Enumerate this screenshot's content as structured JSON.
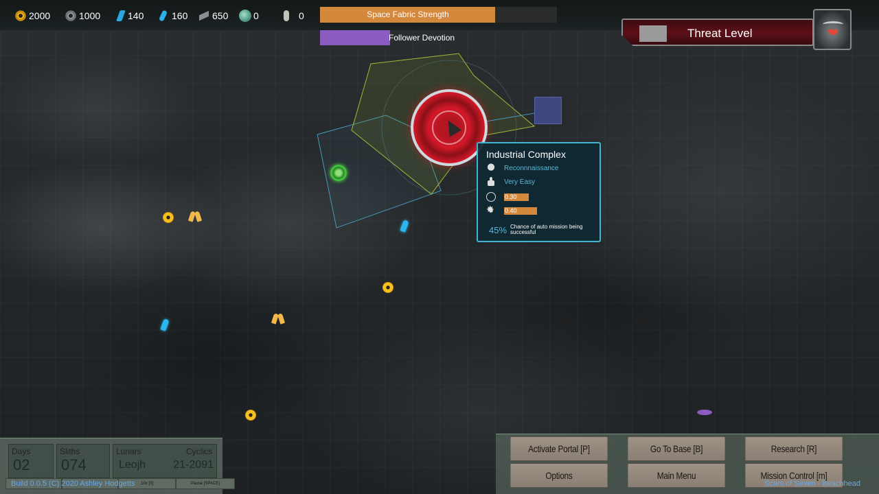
{
  "resources": [
    {
      "icon": "gear-icon",
      "value": "2000"
    },
    {
      "icon": "cog-icon",
      "value": "1000"
    },
    {
      "icon": "crystal-icon",
      "value": "140"
    },
    {
      "icon": "shard-icon",
      "value": "160"
    },
    {
      "icon": "metal-icon",
      "value": "650"
    },
    {
      "icon": "orb-icon",
      "value": "0"
    },
    {
      "icon": "capsule-icon",
      "value": "0"
    }
  ],
  "bars": {
    "fabric_label": "Space Fabric Strength",
    "fabric_fraction": 0.74,
    "fabric_color": "#d4883c",
    "devotion_label": "Follower Devotion",
    "devotion_color": "#8a5cc0"
  },
  "threat": {
    "label": "Threat Level"
  },
  "tooltip": {
    "title": "Industrial Complex",
    "mission_type": "Reconnnaissance",
    "difficulty": "Very Easy",
    "stat1": "0.30",
    "stat2": "0.40",
    "chance_pct": "45%",
    "chance_text": "Chance of auto mission being successful"
  },
  "time": {
    "days_label": "Days",
    "days_value": "02",
    "sliths_label": "Sliths",
    "sliths_value": "074",
    "lunars_label": "Lunars",
    "lunars_value": "Leojh",
    "cyclics_label": "Cyclics",
    "cyclics_value": "21-2091",
    "speed_10x": "10x [3]",
    "speed_pause": "Pause [SPACE]"
  },
  "build_text": "Build 0.0.5 (C) 2020 Ashley Hodgetts",
  "menu": {
    "activate_portal": "Activate Portal [P]",
    "go_to_base": "Go To Base [B]",
    "research": "Research [R]",
    "options": "Options",
    "main_menu": "Main Menu",
    "mission_control": "Mission Control [m]"
  },
  "footer_text": "Scars of Seven - Beachhead"
}
